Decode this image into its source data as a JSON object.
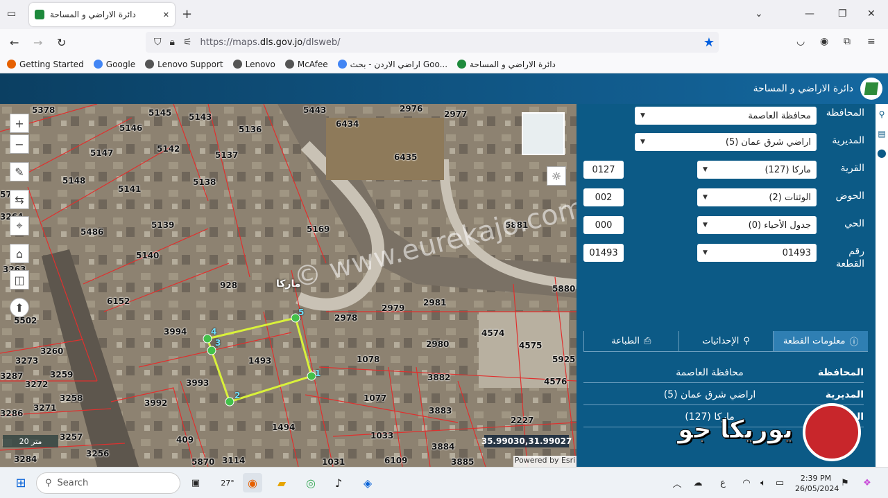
{
  "browser": {
    "tab_title": "دائرة الاراضي و المساحة",
    "tab_close": "✕",
    "new_tab": "+",
    "url_prefix": "https://maps.",
    "url_domain": "dls.gov.jo",
    "url_path": "/dlsweb/",
    "bookmarks": [
      {
        "label": "Getting Started",
        "color": "#e66000"
      },
      {
        "label": "Google",
        "color": "#4285f4"
      },
      {
        "label": "Lenovo Support",
        "color": "#555555"
      },
      {
        "label": "Lenovo",
        "color": "#555555"
      },
      {
        "label": "McAfee",
        "color": "#555555"
      },
      {
        "label": "اراضي الاردن - بحث Goo...",
        "color": "#4285f4"
      },
      {
        "label": "دائرة الاراضي و المساحة",
        "color": "#1e8a3c"
      }
    ]
  },
  "site": {
    "title": "دائرة الاراضي و المساحة"
  },
  "map": {
    "parcels": [
      "5378",
      "5145",
      "5143",
      "5443",
      "2976",
      "2977",
      "5146",
      "5136",
      "6434",
      "6435",
      "5147",
      "5142",
      "5137",
      "5148",
      "5141",
      "5138",
      "5486",
      "5139",
      "5169",
      "5881",
      "5140",
      "6152",
      "928",
      "2979",
      "2981",
      "5880",
      "3994",
      "2978",
      "4574",
      "4575",
      "3260",
      "1493",
      "2980",
      "1078",
      "5925",
      "3273",
      "3259",
      "3993",
      "3882",
      "4576",
      "3287",
      "3272",
      "3992",
      "1077",
      "3258",
      "3271",
      "3883",
      "2227",
      "3286",
      "1494",
      "1033",
      "3257",
      "409",
      "3884",
      "3256",
      "3284",
      "5870",
      "3114",
      "1031",
      "6109",
      "3885",
      "3263",
      "5502",
      "3264",
      "57"
    ],
    "village_label": "ماركا",
    "vertex_labels": [
      "1",
      "2",
      "3",
      "4",
      "5"
    ],
    "scale_label": "20 متر",
    "coords": "35.99030,31.99027",
    "attribution": "Powered by Esri",
    "watermark": "© www.eurekajo.com"
  },
  "form": {
    "governorate": {
      "label": "المحافظة",
      "value": "محافظة العاصمة"
    },
    "directorate": {
      "label": "المديرية",
      "value": "اراضي شرق عمان (5)"
    },
    "village": {
      "label": "القرية",
      "value": "ماركا (127)",
      "code": "0127"
    },
    "basin": {
      "label": "الحوض",
      "value": "الوثنات (2)",
      "code": "002"
    },
    "neighborhood": {
      "label": "الحي",
      "value": "جدول الأحياء (0)",
      "code": "000"
    },
    "plot": {
      "label": "رقم القطعة",
      "value": "01493",
      "code": "01493"
    }
  },
  "tabs": {
    "info": "معلومات القطعة",
    "coordinates": "الإحداثيات",
    "print": "الطباعة"
  },
  "info_rows": [
    {
      "key": "المحافظة",
      "value": "محافظة العاصمة"
    },
    {
      "key": "المديرية",
      "value": "اراضي شرق عمان (5)"
    },
    {
      "key": "القرية",
      "value": "ماركا (127)"
    }
  ],
  "overlay_logo": "يوريكا جو",
  "taskbar": {
    "search_placeholder": "Search",
    "weather": "27°",
    "lang": "ع",
    "time": "2:39 PM",
    "date": "26/05/2024"
  }
}
